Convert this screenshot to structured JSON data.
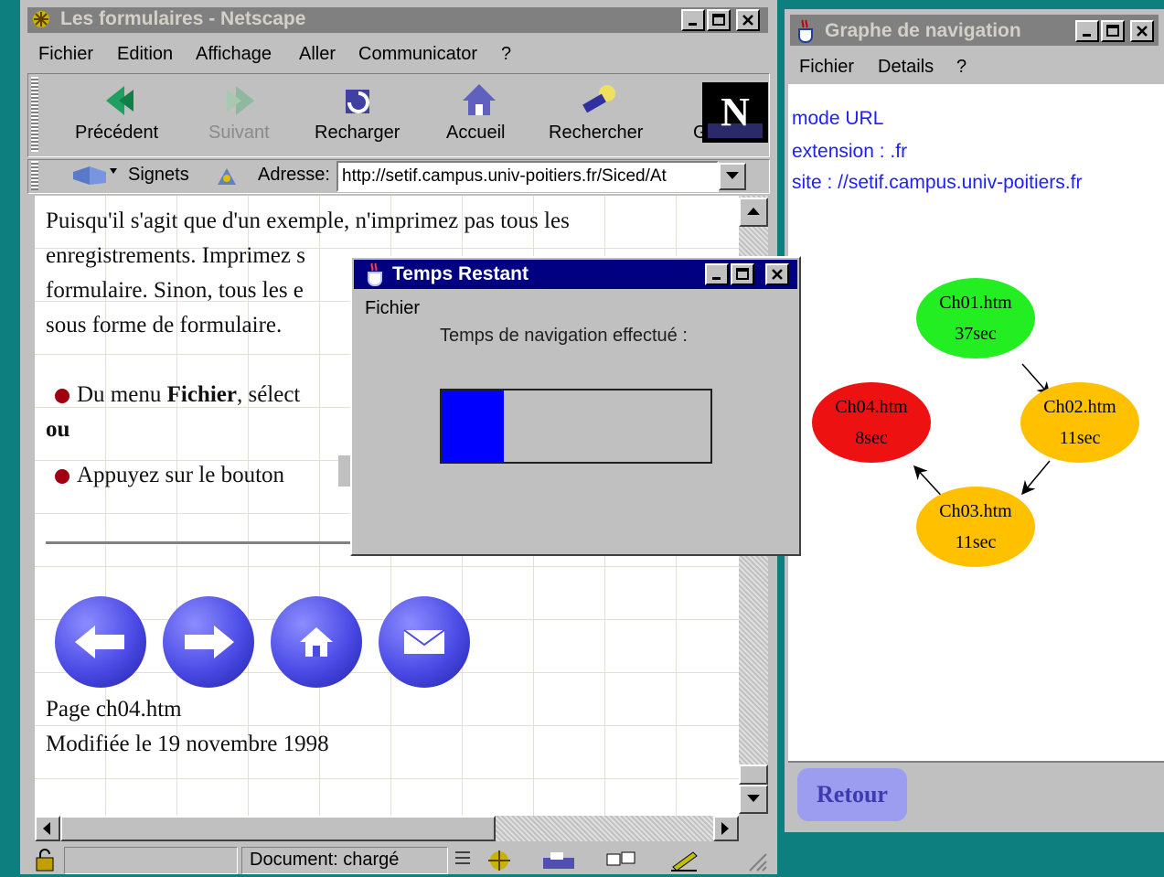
{
  "netscape": {
    "title": "Les formulaires - Netscape",
    "menu": [
      "Fichier",
      "Edition",
      "Affichage",
      "Aller",
      "Communicator",
      "?"
    ],
    "toolbar": {
      "back": "Précédent",
      "forward": "Suivant",
      "reload": "Recharger",
      "home": "Accueil",
      "search": "Rechercher",
      "guide_partial": "G"
    },
    "location": {
      "bookmarks": "Signets",
      "address_label": "Adresse:",
      "url": "http://setif.campus.univ-poitiers.fr/Siced/At"
    },
    "content": {
      "lines": [
        "Puisqu'il s'agit que d'un exemple, n'imprimez pas tous les",
        "enregistrements. Imprimez s",
        "formulaire. Sinon, tous les e",
        "sous forme de formulaire."
      ],
      "bullet1_prefix": "Du menu ",
      "bullet1_bold": "Fichier",
      "bullet1_suffix": ", sélect",
      "ou": "ou",
      "bullet2": "Appuyez sur le bouton",
      "page_name": "Page ch04.htm",
      "modified": "Modifiée le 19 novembre 1998"
    },
    "status": "Document: chargé"
  },
  "graph": {
    "title": "Graphe de navigation",
    "menu": [
      "Fichier",
      "Details",
      "?"
    ],
    "info": [
      "mode URL",
      "extension : .fr",
      "site : //setif.campus.univ-poitiers.fr"
    ],
    "nodes": [
      {
        "name": "Ch01.htm",
        "time": "37sec",
        "color": "#22ee22"
      },
      {
        "name": "Ch02.htm",
        "time": "11sec",
        "color": "#ffc000"
      },
      {
        "name": "Ch03.htm",
        "time": "11sec",
        "color": "#ffc000"
      },
      {
        "name": "Ch04.htm",
        "time": "8sec",
        "color": "#ee1111"
      }
    ],
    "retour": "Retour"
  },
  "dialog": {
    "title": "Temps Restant",
    "menu": "Fichier",
    "label": "Temps de navigation effectué :",
    "progress_fraction": 0.23,
    "progress_color": "#0000ff"
  }
}
